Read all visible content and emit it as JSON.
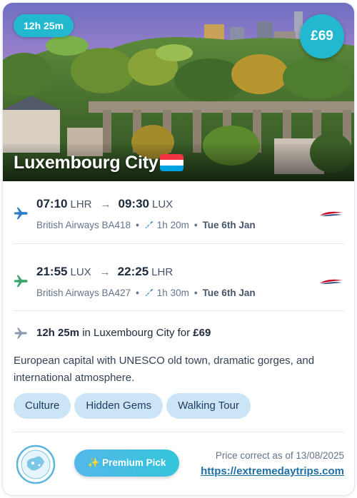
{
  "hero": {
    "duration": "12h 25m",
    "price": "£69",
    "city": "Luxembourg City"
  },
  "outbound": {
    "depart_time": "07:10",
    "depart_code": "LHR",
    "arrow": "→",
    "arrive_time": "09:30",
    "arrive_code": "LUX",
    "airline": "British Airways BA418",
    "duration": "1h 20m",
    "date": "Tue 6th Jan",
    "icon_color": "#2f80c7"
  },
  "return": {
    "depart_time": "21:55",
    "depart_code": "LUX",
    "arrow": "→",
    "arrive_time": "22:25",
    "arrive_code": "LHR",
    "airline": "British Airways BA427",
    "duration": "1h 30m",
    "date": "Tue 6th Jan",
    "icon_color": "#3aa56a"
  },
  "stay": {
    "duration": "12h 25m",
    "in_text": " in Luxembourg City for ",
    "price": "£69"
  },
  "description": "European capital with UNESCO old town, dramatic gorges, and international atmosphere.",
  "tags": [
    "Culture",
    "Hidden Gems",
    "Walking Tour"
  ],
  "footer": {
    "premium_label": "✨ Premium Pick",
    "price_note": "Price correct as of 13/08/2025",
    "site_link": "https://extremedaytrips.com"
  },
  "colors": {
    "accent": "#22b8cf",
    "tag_bg": "#cce5f6",
    "link": "#1e6fa8"
  },
  "icons": {
    "outbound": "plane-takeoff-icon",
    "return": "plane-landing-icon",
    "stay": "plane-icon",
    "airline": "british-airways-logo",
    "flag": "luxembourg-flag-icon",
    "brand": "extreme-day-trips-logo"
  }
}
